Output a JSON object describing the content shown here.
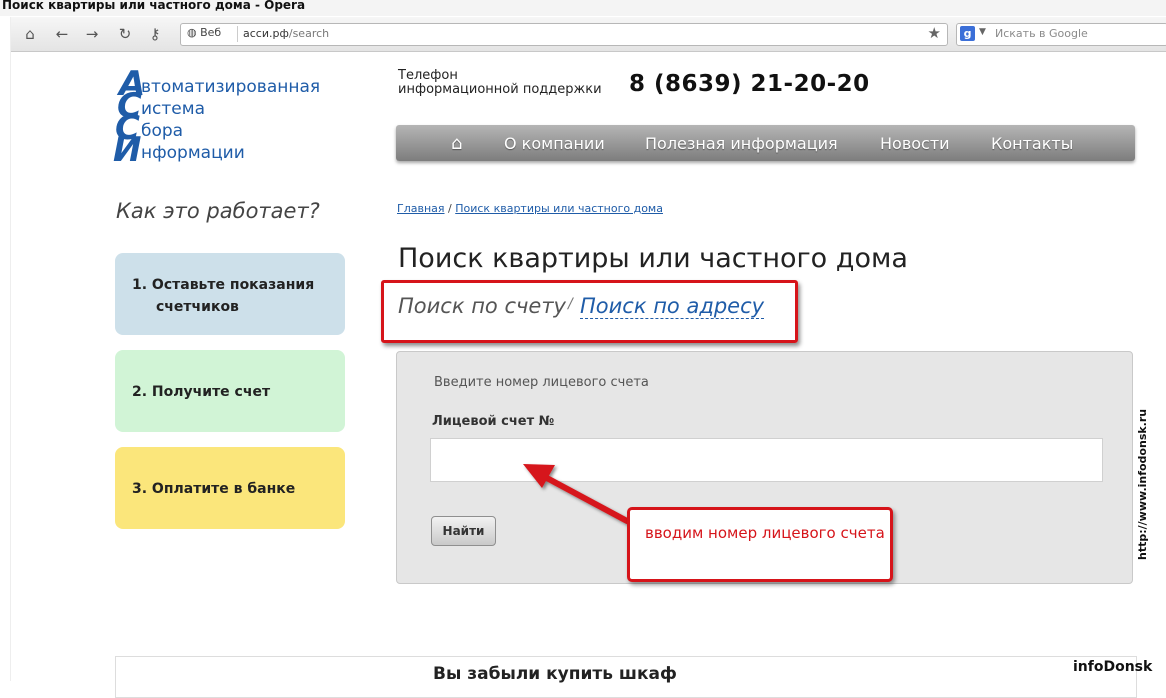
{
  "window": {
    "title": "Поиск квартиры или частного дома - Opera"
  },
  "browser": {
    "site_label": "Веб",
    "url_host": "асси.рф",
    "url_path": "/search",
    "search_engine_letter": "g",
    "search_placeholder": "Искать в Google",
    "icons": [
      "home-icon",
      "back-icon",
      "forward-icon",
      "reload-icon",
      "key-icon",
      "globe-icon",
      "star-icon"
    ]
  },
  "site": {
    "logo": {
      "letters": [
        "А",
        "С",
        "С",
        "И"
      ],
      "words": [
        "втоматизированная",
        "истема",
        "бора",
        "нформации"
      ]
    },
    "phone_label": [
      "Телефон",
      "информационной поддержки"
    ],
    "phone": "8 (8639) 21-20-20",
    "menu": {
      "home_glyph": "⌂",
      "items": [
        "О компании",
        "Полезная информация",
        "Новости",
        "Контакты"
      ]
    }
  },
  "sidebar": {
    "heading": "Как это работает?",
    "steps": [
      {
        "label_line1": "1. Оставьте показания",
        "label_line2": "счетчиков",
        "color": "#cde0ea"
      },
      {
        "label_line1": "2. Получите счет",
        "color": "#d1f4d6"
      },
      {
        "label_line1": "3. Оплатите в банке",
        "color": "#fbe67b"
      }
    ]
  },
  "main": {
    "breadcrumbs": [
      "Главная",
      "Поиск квартиры или частного дома"
    ],
    "breadcrumb_sep": "/",
    "title": "Поиск квартиры или частного дома",
    "tabs": {
      "account": "Поиск по счету",
      "sep": "/",
      "address": "Поиск по адресу"
    },
    "form": {
      "hint": "Введите номер лицевого счета",
      "account_label": "Лицевой счет №",
      "account_value": "",
      "submit": "Найти"
    },
    "callout": "вводим номер лицевого счета",
    "bottom_heading": "Вы забыли купить шкаф"
  },
  "watermark": {
    "side": "http://www.infodonsk.ru",
    "logo": "infoDonsk"
  },
  "colors": {
    "accent": "#1f5ca8",
    "annotation": "#d6141a",
    "menu": "#8f8f8f"
  }
}
